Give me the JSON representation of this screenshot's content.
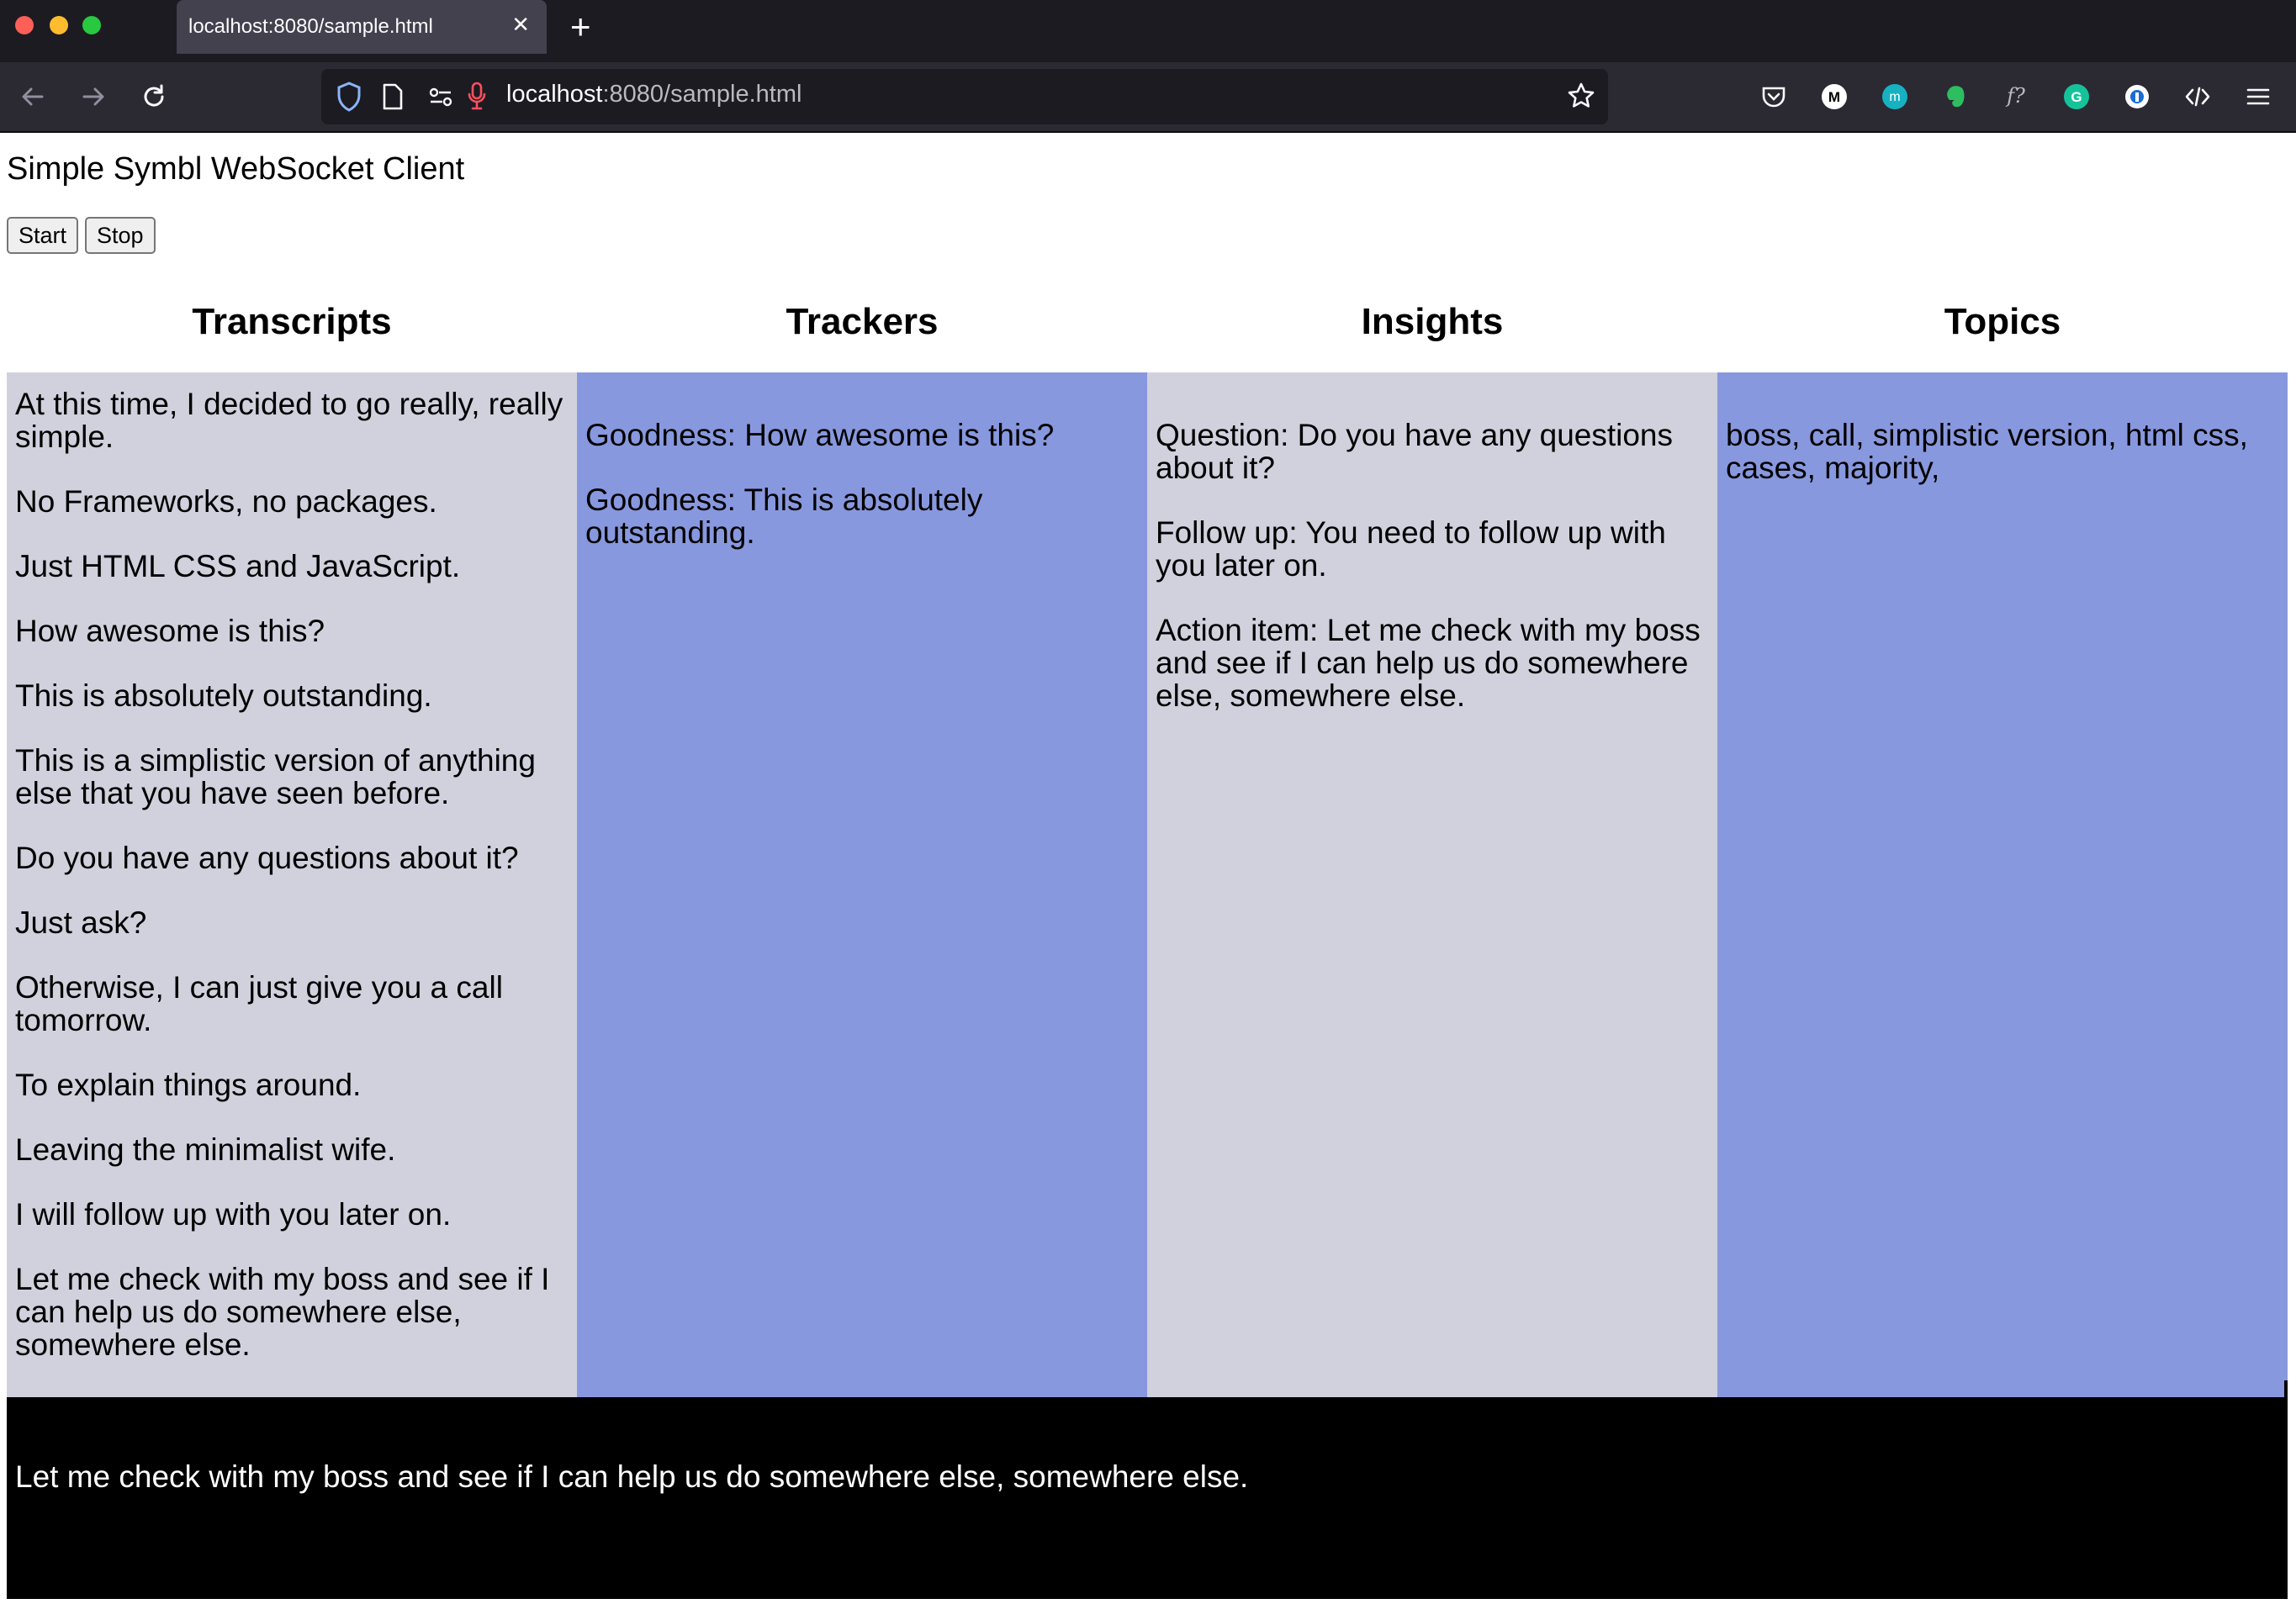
{
  "browser": {
    "tab_title": "localhost:8080/sample.html",
    "tab_close": "✕",
    "new_tab": "+",
    "url_host": "localhost",
    "url_path": ":8080/sample.html"
  },
  "page": {
    "title": "Simple Symbl WebSocket Client",
    "buttons": {
      "start": "Start",
      "stop": "Stop"
    }
  },
  "columns": {
    "transcripts": {
      "heading": "Transcripts",
      "items": [
        "At this time, I decided to go really, really simple.",
        "No Frameworks, no packages.",
        "Just HTML CSS and JavaScript.",
        "How awesome is this?",
        "This is absolutely outstanding.",
        "This is a simplistic version of anything else that you have seen before.",
        "Do you have any questions about it?",
        "Just ask?",
        "Otherwise, I can just give you a call tomorrow.",
        "To explain things around.",
        "Leaving the minimalist wife.",
        "I will follow up with you later on.",
        "Let me check with my boss and see if I can help us do somewhere else, somewhere else."
      ]
    },
    "trackers": {
      "heading": "Trackers",
      "items": [
        "Goodness: How awesome is this?",
        "Goodness: This is absolutely outstanding."
      ]
    },
    "insights": {
      "heading": "Insights",
      "items": [
        "Question: Do you have any questions about it?",
        "Follow up: You need to follow up with you later on.",
        "Action item: Let me check with my boss and see if I can help us do somewhere else, somewhere else."
      ]
    },
    "topics": {
      "heading": "Topics",
      "text": "boss, call, simplistic version, html css, cases, majority,"
    }
  },
  "live_caption": "Let me check with my boss and see if I can help us do somewhere else, somewhere else.",
  "colors": {
    "grey_panel": "#d0d1dd",
    "blue_panel": "#8898de",
    "caption_bg": "#000000"
  }
}
